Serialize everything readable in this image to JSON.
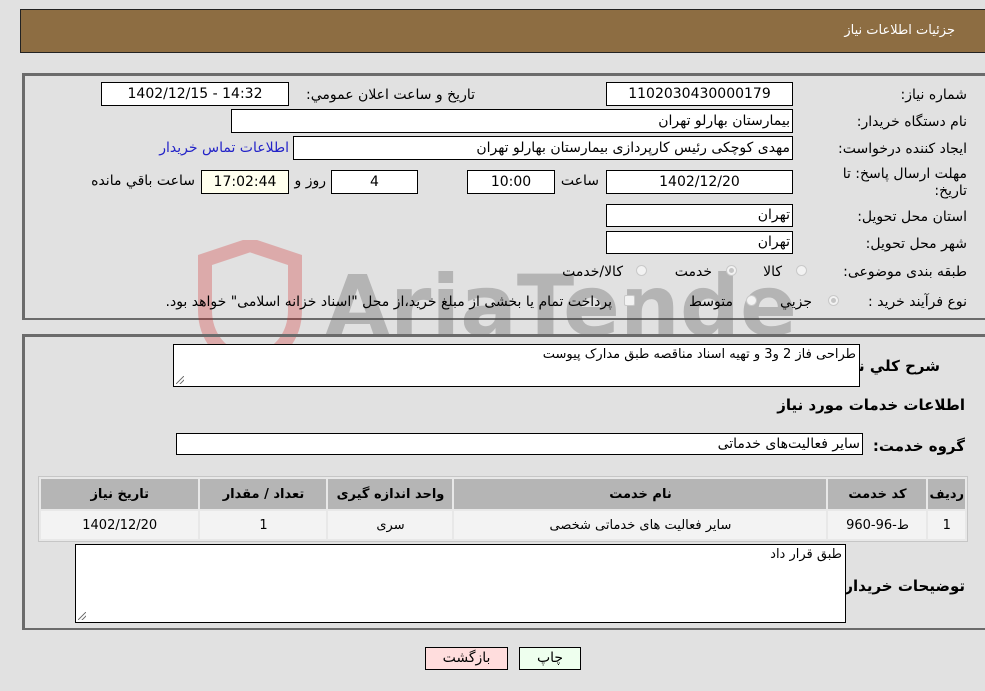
{
  "header": {
    "title": "جزئیات اطلاعات نیاز"
  },
  "form": {
    "need_number": {
      "label": "شماره نیاز:",
      "value": "1102030430000179"
    },
    "announce_datetime": {
      "label": "تاریخ و ساعت اعلان عمومي:",
      "value": "1402/12/15 - 14:32"
    },
    "buyer_org": {
      "label": "نام دستگاه خریدار:",
      "value": "بیمارستان بهارلو تهران"
    },
    "requester": {
      "label": "ایجاد کننده درخواست:",
      "value": "مهدی کوچکی  رئیس کارپردازی بیمارستان بهارلو تهران"
    },
    "buyer_contact_link": "اطلاعات تماس خریدار",
    "deadline": {
      "label_line1": "مهلت ارسال پاسخ: تا",
      "label_line2": "تاریخ:",
      "date": "1402/12/20",
      "time_label": "ساعت",
      "time": "10:00",
      "days": "4",
      "days_label": "روز و",
      "remaining": "17:02:44",
      "remaining_label": "ساعت باقي مانده"
    },
    "delivery_province": {
      "label": "استان محل تحویل:",
      "value": "تهران"
    },
    "delivery_city": {
      "label": "شهر محل تحویل:",
      "value": "تهران"
    },
    "category": {
      "label": "طبقه بندی موضوعی:",
      "options": [
        "کالا",
        "خدمت",
        "کالا/خدمت"
      ],
      "selected": "خدمت"
    },
    "purchase_type": {
      "label": "نوع فرآیند خرید :",
      "options": [
        "جزيي",
        "متوسط"
      ],
      "selected": "جزيي",
      "treasury_note": "پرداخت تمام یا بخشی از مبلغ خرید،از محل \"اسناد خزانه اسلامی\" خواهد بود."
    }
  },
  "details": {
    "general_desc_label": "شرح کلي نیاز:",
    "general_desc": "طراحی فاز 2 و3 و تهیه اسناد مناقصه طبق مدارک پیوست",
    "services_heading": "اطلاعات خدمات مورد نیاز",
    "service_group_label": "گروه خدمت:",
    "service_group": "سایر فعالیت‌های خدماتی",
    "table": {
      "headers": [
        "ردیف",
        "کد خدمت",
        "نام خدمت",
        "واحد اندازه گیری",
        "تعداد / مقدار",
        "تاریخ نیاز"
      ],
      "rows": [
        [
          "1",
          "ط-96-960",
          "سایر فعالیت های خدماتی شخصی",
          "سری",
          "1",
          "1402/12/20"
        ]
      ]
    },
    "buyer_notes_label": "توضیحات خریدار:",
    "buyer_notes": "طبق قرار داد"
  },
  "buttons": {
    "print": "چاپ",
    "back": "بازگشت"
  },
  "watermark": "AriaTender.net",
  "colors": {
    "header_bg": "#8d6d42",
    "link": "#2323c8",
    "print_bg": "#eeffee",
    "back_bg": "#ffdddd"
  }
}
